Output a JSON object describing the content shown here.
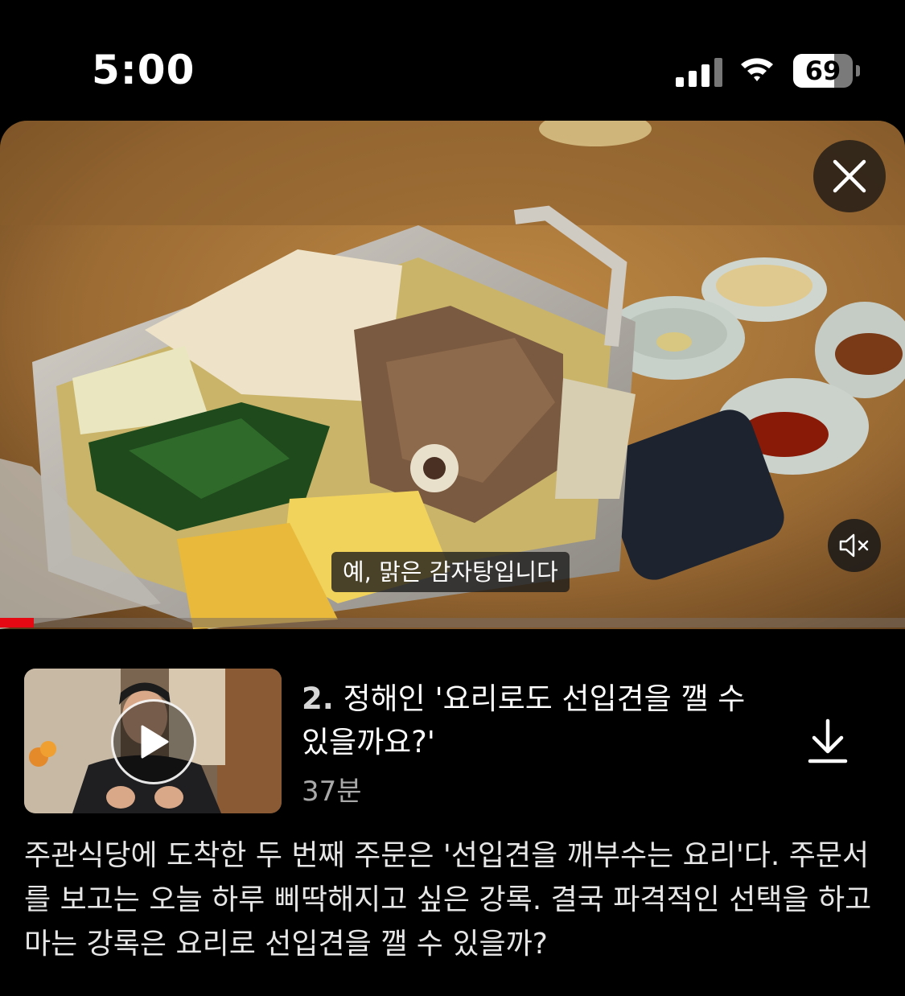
{
  "status_bar": {
    "time": "5:00",
    "battery_level": "69",
    "battery_fraction": 0.69,
    "signal_bars_active": 3,
    "signal_bars_total": 4
  },
  "player": {
    "subtitle": "예, 맑은 감자탕입니다",
    "progress_fraction": 0.037,
    "close_icon": "close-icon",
    "mute_icon": "speaker-muted-icon"
  },
  "episode": {
    "number": "2.",
    "title": "정해인 '요리로도 선입견을 깰 수 있을까요?'",
    "duration": "37분",
    "play_icon": "play-icon",
    "download_icon": "download-icon",
    "synopsis": "주관식당에 도착한 두 번째 주문은 '선입견을 깨부수는 요리'다. 주문서를 보고는 오늘 하루 삐딱해지고 싶은 강록. 결국 파격적인 선택을 하고 마는 강록은 요리로 선입견을 깰 수 있을까?"
  },
  "colors": {
    "background": "#000000",
    "accent": "#e50914",
    "secondary_text": "#a9a9a9"
  }
}
